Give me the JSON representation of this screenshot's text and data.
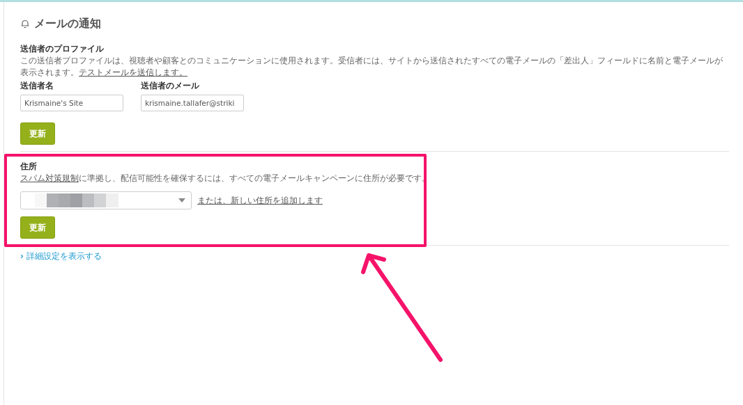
{
  "title": "メールの通知",
  "sender_profile": {
    "heading": "送信者のプロファイル",
    "description": "この送信者プロファイルは、視聴者や顧客とのコミュニケーションに使用されます。受信者には、サイトから送信されたすべての電子メールの「差出人」フィールドに名前と電子メールが表示されます。",
    "link": "テストメールを送信します。",
    "fields": [
      {
        "label": "送信者名",
        "value": "Krismaine's Site"
      },
      {
        "label": "送信者のメール",
        "value": "krismaine.tallafer@striki"
      }
    ],
    "button": "更新"
  },
  "address": {
    "heading": "住所",
    "link": "スパム対策規制",
    "description": "に準拠し、配信可能性を確保するには、すべての電子メールキャンペーンに住所が必要です。",
    "add_link": "または、新しい住所を追加します",
    "button": "更新",
    "highlighted": true
  },
  "advanced_link": {
    "icon": "›",
    "label": "詳細設定を表示する"
  }
}
